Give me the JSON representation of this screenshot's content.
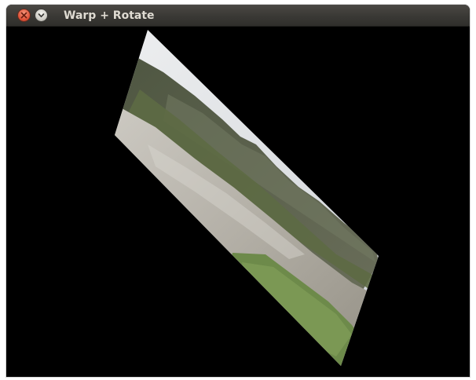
{
  "window": {
    "title": "Warp + Rotate"
  },
  "titlebar": {
    "close_icon": "close-icon",
    "menu_icon": "chevron-down-icon"
  },
  "content": {
    "image": "warped-rotated-landscape",
    "colors": {
      "background": "#000000",
      "sky": "#e6e8ea",
      "hills": "#59604a",
      "ground": "#b9b6ad",
      "grass": "#6f8a4c"
    }
  }
}
